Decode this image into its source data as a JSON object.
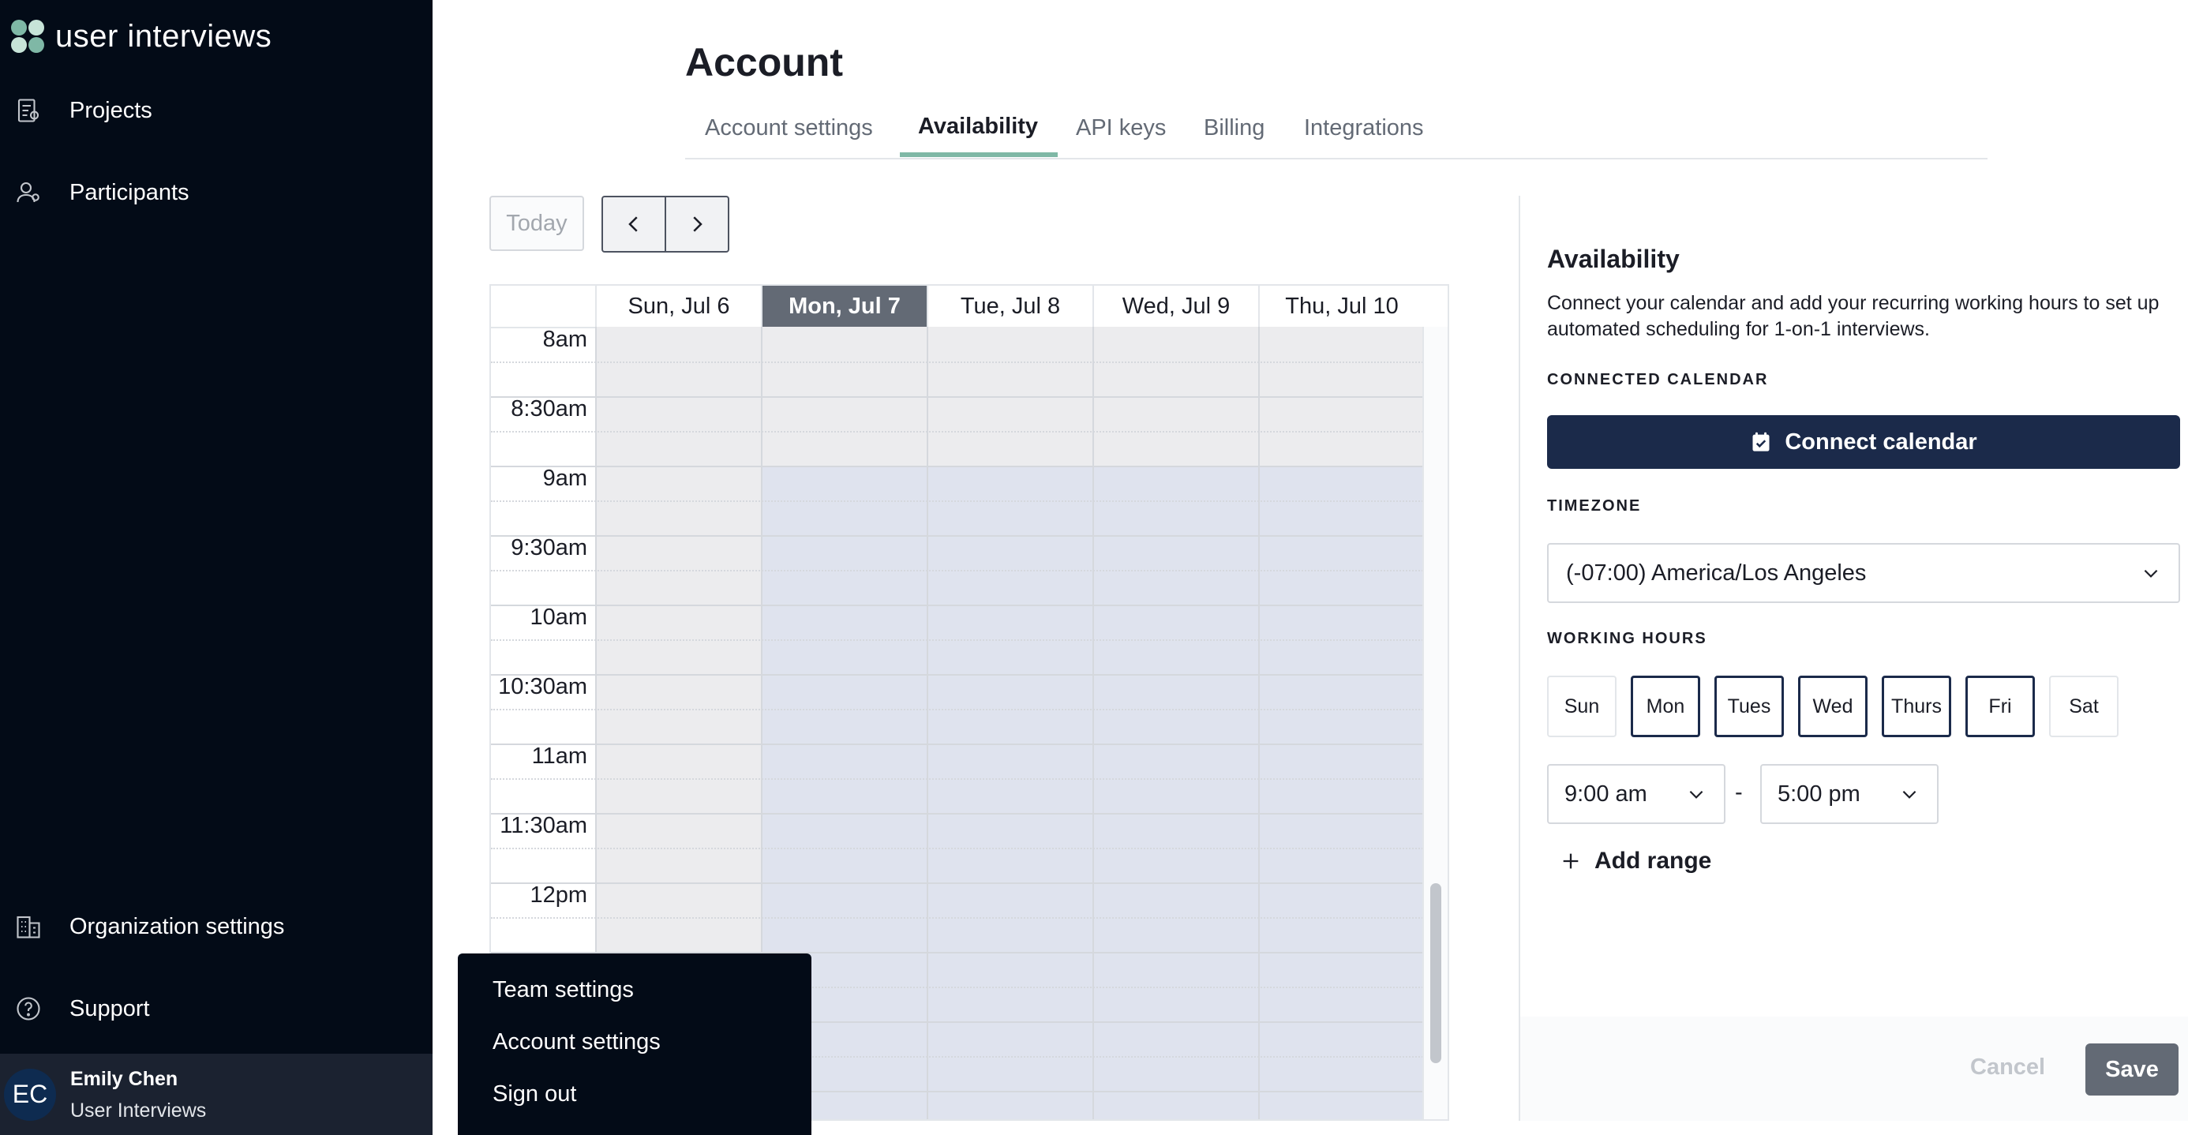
{
  "app": {
    "logo_text": "user interviews"
  },
  "sidebar": {
    "items": [
      {
        "label": "Projects",
        "icon": "projects-icon"
      },
      {
        "label": "Participants",
        "icon": "participants-icon"
      }
    ],
    "bottom_items": [
      {
        "label": "Organization settings",
        "icon": "organization-icon"
      },
      {
        "label": "Support",
        "icon": "help-icon"
      }
    ],
    "user": {
      "initials": "EC",
      "name": "Emily Chen",
      "org": "User Interviews"
    }
  },
  "user_menu": {
    "items": [
      "Team settings",
      "Account settings",
      "Sign out"
    ]
  },
  "page": {
    "title": "Account",
    "tabs": [
      "Account settings",
      "Availability",
      "API keys",
      "Billing",
      "Integrations"
    ],
    "active_tab": "Availability"
  },
  "calendar": {
    "today_label": "Today",
    "days": [
      "Sun, Jul 6",
      "Mon, Jul 7",
      "Tue, Jul 8",
      "Wed, Jul 9",
      "Thu, Jul 10"
    ],
    "today_index": 1,
    "times": [
      "8am",
      "8:30am",
      "9am",
      "9:30am",
      "10am",
      "10:30am",
      "11am",
      "11:30am",
      "12pm"
    ],
    "colors": {
      "unavailable": "#ececee",
      "available": "#dfe3ee",
      "today_header": "#636a75"
    }
  },
  "availability_panel": {
    "title": "Availability",
    "description": "Connect your calendar and add your recurring working hours to set up automated scheduling for 1-on-1 interviews.",
    "connected_calendar_label": "CONNECTED CALENDAR",
    "connect_button": "Connect calendar",
    "timezone_label": "TIMEZONE",
    "timezone_value": "(-07:00) America/Los Angeles",
    "working_hours_label": "WORKING HOURS",
    "days": [
      {
        "label": "Sun",
        "selected": false
      },
      {
        "label": "Mon",
        "selected": true
      },
      {
        "label": "Tues",
        "selected": true
      },
      {
        "label": "Wed",
        "selected": true
      },
      {
        "label": "Thurs",
        "selected": true
      },
      {
        "label": "Fri",
        "selected": true
      },
      {
        "label": "Sat",
        "selected": false
      }
    ],
    "start_time": "9:00 am",
    "separator": "-",
    "end_time": "5:00 pm",
    "add_range": "Add range",
    "cancel": "Cancel",
    "save": "Save"
  }
}
